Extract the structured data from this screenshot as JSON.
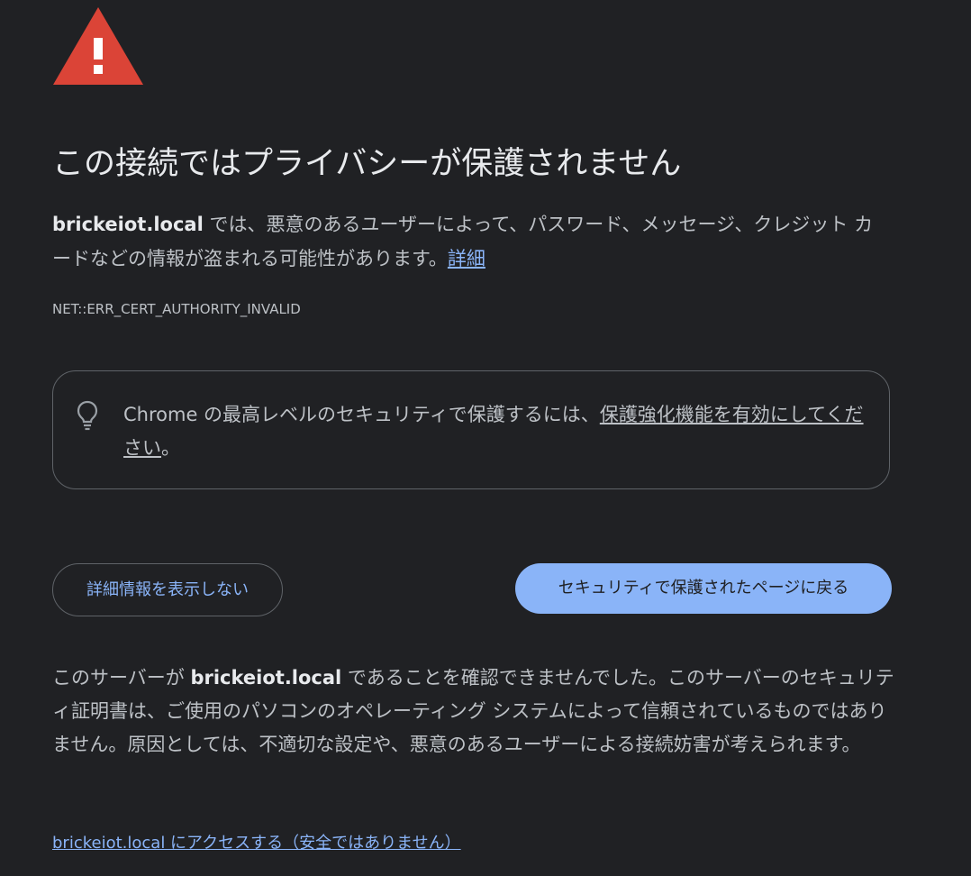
{
  "theme": {
    "background": "#202124",
    "heading_color": "#e8eaed",
    "text_color": "#bdc1c6",
    "link_color": "#8ab4f8",
    "primary_button_bg": "#8ab4f8",
    "warning_red": "#db4437"
  },
  "icons": {
    "warning": "warning-triangle-icon",
    "bulb": "lightbulb-icon"
  },
  "heading": "この接続ではプライバシーが保護されません",
  "description": {
    "host": "brickeiot.local",
    "text": " では、悪意のあるユーザーによって、パスワード、メッセージ、クレジット カードなどの情報が盗まれる可能性があります。",
    "learn_more": "詳細"
  },
  "error_code": "NET::ERR_CERT_AUTHORITY_INVALID",
  "enhanced_protection": {
    "text": "Chrome の最高レベルのセキュリティで保護するには、",
    "link": "保護強化機能を有効にしてください",
    "suffix": "。"
  },
  "buttons": {
    "hide_details": "詳細情報を表示しない",
    "back_to_safety": "セキュリティで保護されたページに戻る"
  },
  "details": {
    "prefix": "このサーバーが ",
    "host": "brickeiot.local",
    "text": " であることを確認できませんでした。このサーバーのセキュリティ証明書は、ご使用のパソコンのオペレーティング システムによって信頼されているものではありません。原因としては、不適切な設定や、悪意のあるユーザーによる接続妨害が考えられます。"
  },
  "proceed_link": "brickeiot.local にアクセスする（安全ではありません）"
}
